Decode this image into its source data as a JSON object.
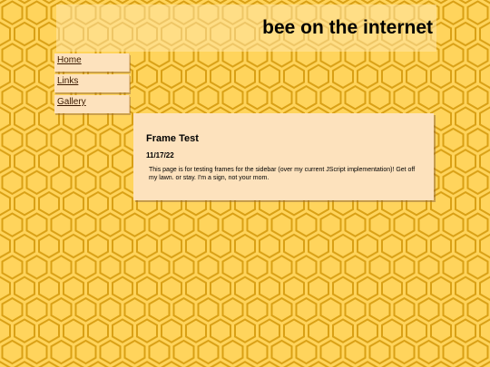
{
  "site": {
    "title": "bee on the internet"
  },
  "sidebar": {
    "items": [
      {
        "label": "Home"
      },
      {
        "label": "Links"
      },
      {
        "label": "Gallery"
      }
    ]
  },
  "post": {
    "title": "Frame Test",
    "date": "11/17/22",
    "body": "This page is for testing frames for the sidebar (over my current JScript implementation)! Get off my lawn. or stay. I'm a sign, not your mom."
  },
  "colors": {
    "background": "#ffd45c",
    "hexagon_stroke": "#d9a015",
    "panel": "#fde2bd",
    "link": "#3a1a00"
  },
  "icons": {
    "background_pattern": "honeycomb-pattern"
  }
}
